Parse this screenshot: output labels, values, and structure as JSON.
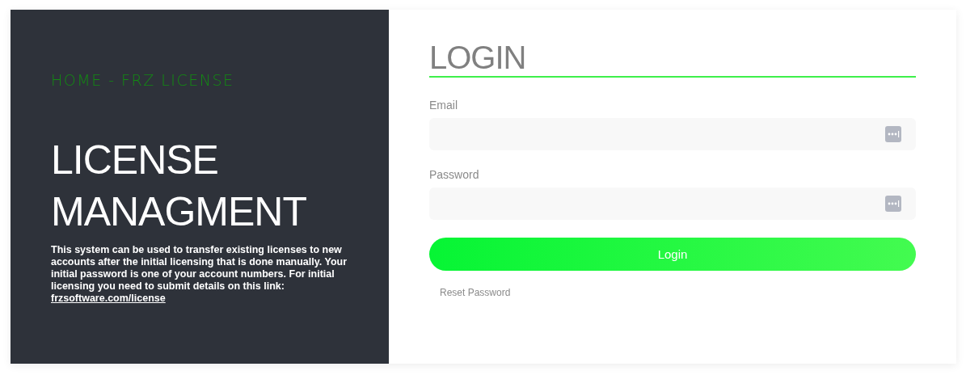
{
  "breadcrumb": "HOME - FRZ LICENSE",
  "title": "LICENSE MANAGMENT",
  "description": "This system can be used to transfer existing licenses to new accounts after the initial licensing that is done manually. Your initial password is one of your account numbers. For initial licensing you need to submit details on this link:",
  "link": "frzsoftware.com/license",
  "login": {
    "heading": "LOGIN",
    "fields": [
      {
        "label": "Email"
      },
      {
        "label": "Password"
      }
    ],
    "button": "Login",
    "reset_link": "Reset Password"
  }
}
